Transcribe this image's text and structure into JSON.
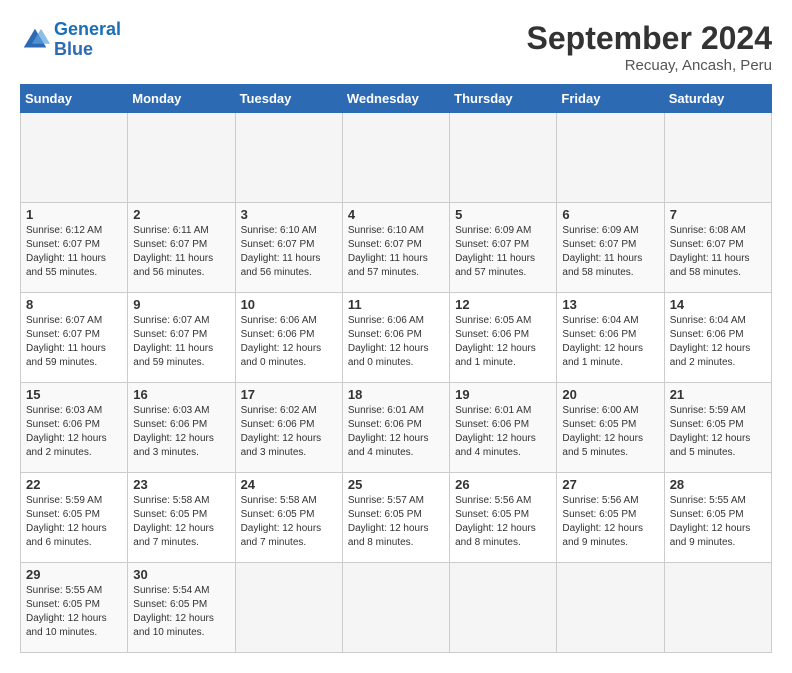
{
  "header": {
    "logo_general": "General",
    "logo_blue": "Blue",
    "month_title": "September 2024",
    "subtitle": "Recuay, Ancash, Peru"
  },
  "calendar": {
    "days_of_week": [
      "Sunday",
      "Monday",
      "Tuesday",
      "Wednesday",
      "Thursday",
      "Friday",
      "Saturday"
    ],
    "weeks": [
      [
        {
          "day": "",
          "detail": ""
        },
        {
          "day": "",
          "detail": ""
        },
        {
          "day": "",
          "detail": ""
        },
        {
          "day": "",
          "detail": ""
        },
        {
          "day": "",
          "detail": ""
        },
        {
          "day": "",
          "detail": ""
        },
        {
          "day": "",
          "detail": ""
        }
      ],
      [
        {
          "day": "1",
          "detail": "Sunrise: 6:12 AM\nSunset: 6:07 PM\nDaylight: 11 hours\nand 55 minutes."
        },
        {
          "day": "2",
          "detail": "Sunrise: 6:11 AM\nSunset: 6:07 PM\nDaylight: 11 hours\nand 56 minutes."
        },
        {
          "day": "3",
          "detail": "Sunrise: 6:10 AM\nSunset: 6:07 PM\nDaylight: 11 hours\nand 56 minutes."
        },
        {
          "day": "4",
          "detail": "Sunrise: 6:10 AM\nSunset: 6:07 PM\nDaylight: 11 hours\nand 57 minutes."
        },
        {
          "day": "5",
          "detail": "Sunrise: 6:09 AM\nSunset: 6:07 PM\nDaylight: 11 hours\nand 57 minutes."
        },
        {
          "day": "6",
          "detail": "Sunrise: 6:09 AM\nSunset: 6:07 PM\nDaylight: 11 hours\nand 58 minutes."
        },
        {
          "day": "7",
          "detail": "Sunrise: 6:08 AM\nSunset: 6:07 PM\nDaylight: 11 hours\nand 58 minutes."
        }
      ],
      [
        {
          "day": "8",
          "detail": "Sunrise: 6:07 AM\nSunset: 6:07 PM\nDaylight: 11 hours\nand 59 minutes."
        },
        {
          "day": "9",
          "detail": "Sunrise: 6:07 AM\nSunset: 6:07 PM\nDaylight: 11 hours\nand 59 minutes."
        },
        {
          "day": "10",
          "detail": "Sunrise: 6:06 AM\nSunset: 6:06 PM\nDaylight: 12 hours\nand 0 minutes."
        },
        {
          "day": "11",
          "detail": "Sunrise: 6:06 AM\nSunset: 6:06 PM\nDaylight: 12 hours\nand 0 minutes."
        },
        {
          "day": "12",
          "detail": "Sunrise: 6:05 AM\nSunset: 6:06 PM\nDaylight: 12 hours\nand 1 minute."
        },
        {
          "day": "13",
          "detail": "Sunrise: 6:04 AM\nSunset: 6:06 PM\nDaylight: 12 hours\nand 1 minute."
        },
        {
          "day": "14",
          "detail": "Sunrise: 6:04 AM\nSunset: 6:06 PM\nDaylight: 12 hours\nand 2 minutes."
        }
      ],
      [
        {
          "day": "15",
          "detail": "Sunrise: 6:03 AM\nSunset: 6:06 PM\nDaylight: 12 hours\nand 2 minutes."
        },
        {
          "day": "16",
          "detail": "Sunrise: 6:03 AM\nSunset: 6:06 PM\nDaylight: 12 hours\nand 3 minutes."
        },
        {
          "day": "17",
          "detail": "Sunrise: 6:02 AM\nSunset: 6:06 PM\nDaylight: 12 hours\nand 3 minutes."
        },
        {
          "day": "18",
          "detail": "Sunrise: 6:01 AM\nSunset: 6:06 PM\nDaylight: 12 hours\nand 4 minutes."
        },
        {
          "day": "19",
          "detail": "Sunrise: 6:01 AM\nSunset: 6:06 PM\nDaylight: 12 hours\nand 4 minutes."
        },
        {
          "day": "20",
          "detail": "Sunrise: 6:00 AM\nSunset: 6:05 PM\nDaylight: 12 hours\nand 5 minutes."
        },
        {
          "day": "21",
          "detail": "Sunrise: 5:59 AM\nSunset: 6:05 PM\nDaylight: 12 hours\nand 5 minutes."
        }
      ],
      [
        {
          "day": "22",
          "detail": "Sunrise: 5:59 AM\nSunset: 6:05 PM\nDaylight: 12 hours\nand 6 minutes."
        },
        {
          "day": "23",
          "detail": "Sunrise: 5:58 AM\nSunset: 6:05 PM\nDaylight: 12 hours\nand 7 minutes."
        },
        {
          "day": "24",
          "detail": "Sunrise: 5:58 AM\nSunset: 6:05 PM\nDaylight: 12 hours\nand 7 minutes."
        },
        {
          "day": "25",
          "detail": "Sunrise: 5:57 AM\nSunset: 6:05 PM\nDaylight: 12 hours\nand 8 minutes."
        },
        {
          "day": "26",
          "detail": "Sunrise: 5:56 AM\nSunset: 6:05 PM\nDaylight: 12 hours\nand 8 minutes."
        },
        {
          "day": "27",
          "detail": "Sunrise: 5:56 AM\nSunset: 6:05 PM\nDaylight: 12 hours\nand 9 minutes."
        },
        {
          "day": "28",
          "detail": "Sunrise: 5:55 AM\nSunset: 6:05 PM\nDaylight: 12 hours\nand 9 minutes."
        }
      ],
      [
        {
          "day": "29",
          "detail": "Sunrise: 5:55 AM\nSunset: 6:05 PM\nDaylight: 12 hours\nand 10 minutes."
        },
        {
          "day": "30",
          "detail": "Sunrise: 5:54 AM\nSunset: 6:05 PM\nDaylight: 12 hours\nand 10 minutes."
        },
        {
          "day": "",
          "detail": ""
        },
        {
          "day": "",
          "detail": ""
        },
        {
          "day": "",
          "detail": ""
        },
        {
          "day": "",
          "detail": ""
        },
        {
          "day": "",
          "detail": ""
        }
      ]
    ]
  }
}
